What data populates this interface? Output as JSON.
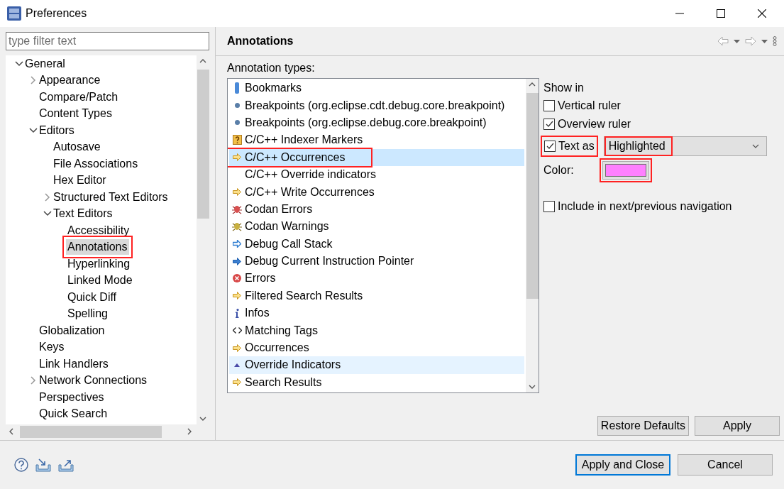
{
  "window": {
    "title": "Preferences"
  },
  "filter": {
    "placeholder": "type filter text"
  },
  "tree": [
    {
      "label": "General",
      "expanded": true,
      "selected": false,
      "highlighted": false,
      "children": [
        {
          "label": "Appearance",
          "expanded": false,
          "selected": false,
          "highlighted": false
        },
        {
          "label": "Compare/Patch",
          "selected": false,
          "highlighted": false
        },
        {
          "label": "Content Types",
          "selected": false,
          "highlighted": false
        },
        {
          "label": "Editors",
          "expanded": true,
          "selected": false,
          "highlighted": false,
          "children": [
            {
              "label": "Autosave",
              "selected": false,
              "highlighted": false
            },
            {
              "label": "File Associations",
              "selected": false,
              "highlighted": false
            },
            {
              "label": "Hex Editor",
              "selected": false,
              "highlighted": false
            },
            {
              "label": "Structured Text Editors",
              "expanded": false,
              "selected": false,
              "highlighted": false
            },
            {
              "label": "Text Editors",
              "expanded": true,
              "selected": false,
              "highlighted": false,
              "children": [
                {
                  "label": "Accessibility",
                  "selected": false,
                  "highlighted": false
                },
                {
                  "label": "Annotations",
                  "selected": true,
                  "highlighted": true
                },
                {
                  "label": "Hyperlinking",
                  "selected": false,
                  "highlighted": false
                },
                {
                  "label": "Linked Mode",
                  "selected": false,
                  "highlighted": false
                },
                {
                  "label": "Quick Diff",
                  "selected": false,
                  "highlighted": false
                },
                {
                  "label": "Spelling",
                  "selected": false,
                  "highlighted": false
                }
              ]
            }
          ]
        },
        {
          "label": "Globalization",
          "selected": false,
          "highlighted": false
        },
        {
          "label": "Keys",
          "selected": false,
          "highlighted": false
        },
        {
          "label": "Link Handlers",
          "selected": false,
          "highlighted": false
        },
        {
          "label": "Network Connections",
          "expanded": false,
          "selected": false,
          "highlighted": false
        },
        {
          "label": "Perspectives",
          "selected": false,
          "highlighted": false
        },
        {
          "label": "Quick Search",
          "selected": false,
          "highlighted": false
        }
      ]
    }
  ],
  "page": {
    "title": "Annotations",
    "list_label": "Annotation types:",
    "annotation_types": [
      {
        "label": "Bookmarks",
        "kind": "bookmark",
        "selected": false,
        "hovered": false,
        "highlighted": false
      },
      {
        "label": "Breakpoints (org.eclipse.cdt.debug.core.breakpoint)",
        "kind": "dot",
        "selected": false,
        "hovered": false,
        "highlighted": false
      },
      {
        "label": "Breakpoints (org.eclipse.debug.core.breakpoint)",
        "kind": "dot",
        "selected": false,
        "hovered": false,
        "highlighted": false
      },
      {
        "label": "C/C++ Indexer Markers",
        "kind": "question",
        "selected": false,
        "hovered": false,
        "highlighted": false
      },
      {
        "label": "C/C++ Occurrences",
        "kind": "arrow-yellow",
        "selected": true,
        "hovered": false,
        "highlighted": true
      },
      {
        "label": "C/C++ Override indicators",
        "kind": "plain",
        "selected": false,
        "hovered": false,
        "highlighted": false
      },
      {
        "label": "C/C++ Write Occurrences",
        "kind": "arrow-yellow",
        "selected": false,
        "hovered": false,
        "highlighted": false
      },
      {
        "label": "Codan Errors",
        "kind": "bug-red",
        "selected": false,
        "hovered": false,
        "highlighted": false
      },
      {
        "label": "Codan Warnings",
        "kind": "bug-yellow",
        "selected": false,
        "hovered": false,
        "highlighted": false
      },
      {
        "label": "Debug Call Stack",
        "kind": "arrow-blue-outline",
        "selected": false,
        "hovered": false,
        "highlighted": false
      },
      {
        "label": "Debug Current Instruction Pointer",
        "kind": "arrow-blue",
        "selected": false,
        "hovered": false,
        "highlighted": false
      },
      {
        "label": "Errors",
        "kind": "error",
        "selected": false,
        "hovered": false,
        "highlighted": false
      },
      {
        "label": "Filtered Search Results",
        "kind": "arrow-yellow",
        "selected": false,
        "hovered": false,
        "highlighted": false
      },
      {
        "label": "Infos",
        "kind": "info",
        "selected": false,
        "hovered": false,
        "highlighted": false
      },
      {
        "label": "Matching Tags",
        "kind": "tags",
        "selected": false,
        "hovered": false,
        "highlighted": false
      },
      {
        "label": "Occurrences",
        "kind": "arrow-yellow",
        "selected": false,
        "hovered": false,
        "highlighted": false
      },
      {
        "label": "Override Indicators",
        "kind": "triangle",
        "selected": false,
        "hovered": true,
        "highlighted": false
      },
      {
        "label": "Search Results",
        "kind": "arrow-yellow",
        "selected": false,
        "hovered": false,
        "highlighted": false
      }
    ],
    "show_in": {
      "heading": "Show in",
      "vertical_ruler": {
        "label": "Vertical ruler",
        "checked": false
      },
      "overview_ruler": {
        "label": "Overview ruler",
        "checked": true
      },
      "text_as": {
        "label": "Text as",
        "checked": true,
        "highlighted": true,
        "style": "Highlighted",
        "style_highlighted": true
      },
      "color": {
        "label": "Color:",
        "color": "#ff80ff",
        "highlighted": true
      },
      "navigation": {
        "label": "Include in next/previous navigation",
        "checked": false
      }
    },
    "restore_defaults": "Restore Defaults",
    "apply": "Apply"
  },
  "footer": {
    "buttons": [
      {
        "label": "Apply and Close",
        "default": true
      },
      {
        "label": "Cancel",
        "default": false
      }
    ]
  }
}
